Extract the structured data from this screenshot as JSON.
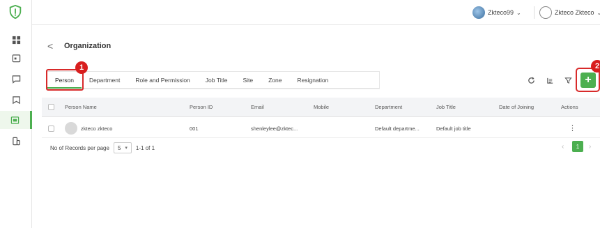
{
  "topbar": {
    "user1": {
      "name": "Zkteco99",
      "chevron": "⌄"
    },
    "user2": {
      "name": "Zkteco Zkteco",
      "chevron": "⌄"
    }
  },
  "sidebar": {
    "icons": [
      "shield-logo",
      "dashboard-icon",
      "calendar-icon",
      "message-icon",
      "ribbon-icon",
      "personnel-icon",
      "device-icon"
    ]
  },
  "header": {
    "back": "<",
    "title": "Organization"
  },
  "tabs": [
    {
      "label": "Person"
    },
    {
      "label": "Department"
    },
    {
      "label": "Role and Permission"
    },
    {
      "label": "Job Title"
    },
    {
      "label": "Site"
    },
    {
      "label": "Zone"
    },
    {
      "label": "Resignation"
    }
  ],
  "steps": {
    "one": "1",
    "two": "2"
  },
  "toolbar": {
    "add_label": "+"
  },
  "table": {
    "columns": [
      "Person Name",
      "Person ID",
      "Email",
      "Mobile",
      "Department",
      "Job Title",
      "Date of Joining",
      "Actions"
    ],
    "rows": [
      {
        "name": "zkteco zkteco",
        "id": "001",
        "email": "shenleylee@zktec...",
        "mobile": "",
        "department": "Default departme...",
        "job_title": "Default job title",
        "date_of_joining": "",
        "actions": "⋮"
      }
    ]
  },
  "footer": {
    "records_label": "No of Records per page",
    "page_size": "5",
    "dropdown": "▾",
    "range": "1-1 of 1",
    "prev": "‹",
    "next": "›",
    "current_page": "1"
  },
  "colors": {
    "accent": "#4caf50",
    "highlight": "#d82a2a"
  }
}
